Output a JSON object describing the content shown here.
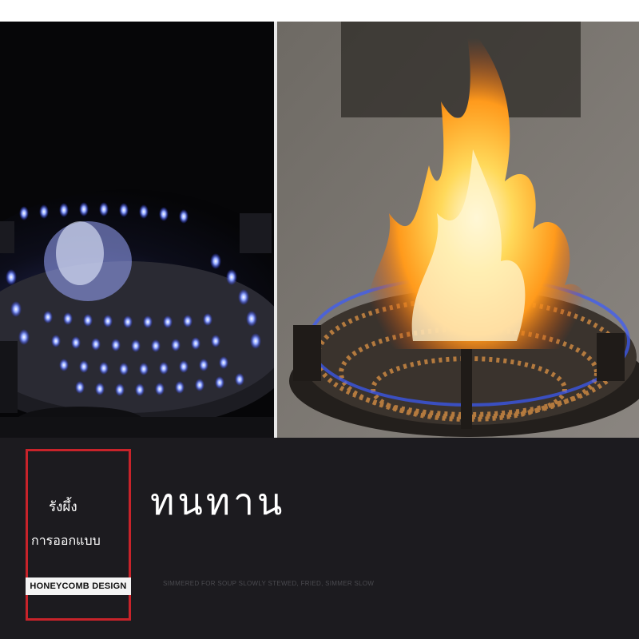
{
  "photos": {
    "left": {
      "description_icon": "blue-flame-burner-icon"
    },
    "right": {
      "description_icon": "orange-flame-burner-icon"
    }
  },
  "brand": {
    "line1": "รังผึ้ง",
    "line2": "การออกแบบ",
    "label": "HONEYCOMB DESIGN",
    "accent_color": "#c8232a"
  },
  "headline": "ทนทาน",
  "tagline": "SIMMERED FOR SOUP SLOWLY STEWED, FRIED, SIMMER SLOW"
}
